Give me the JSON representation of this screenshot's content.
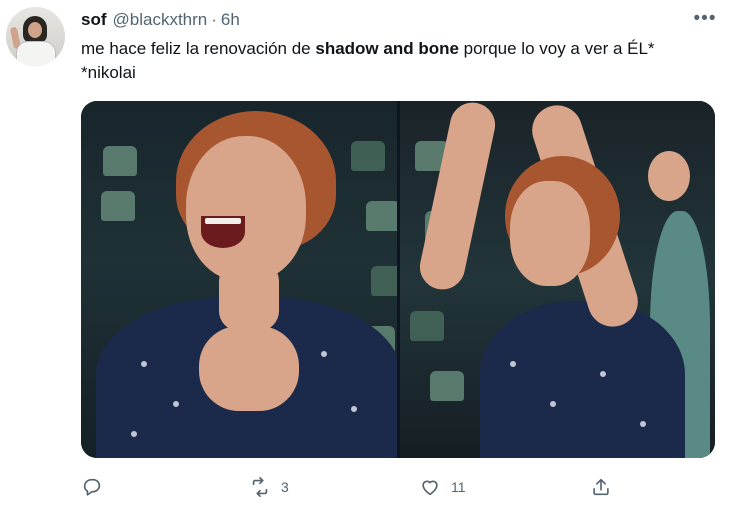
{
  "tweet": {
    "display_name": "sof",
    "handle": "@blackxthrn",
    "separator": "·",
    "time": "6h",
    "text_line1_before": "me hace feliz la renovación de ",
    "text_line1_bold": "shadow and bone",
    "text_line1_after": " porque lo voy a ver a ÉL*",
    "text_line2": "*nikolai",
    "more_icon": "more-horizontal-icon",
    "more_glyph": "•••"
  },
  "media": {
    "description_icons": [
      "photo-left",
      "photo-right"
    ]
  },
  "actions": {
    "reply": {
      "icon": "reply-icon",
      "count": ""
    },
    "retweet": {
      "icon": "retweet-icon",
      "count": "3"
    },
    "like": {
      "icon": "like-icon",
      "count": "11"
    },
    "share": {
      "icon": "share-icon",
      "count": ""
    }
  }
}
